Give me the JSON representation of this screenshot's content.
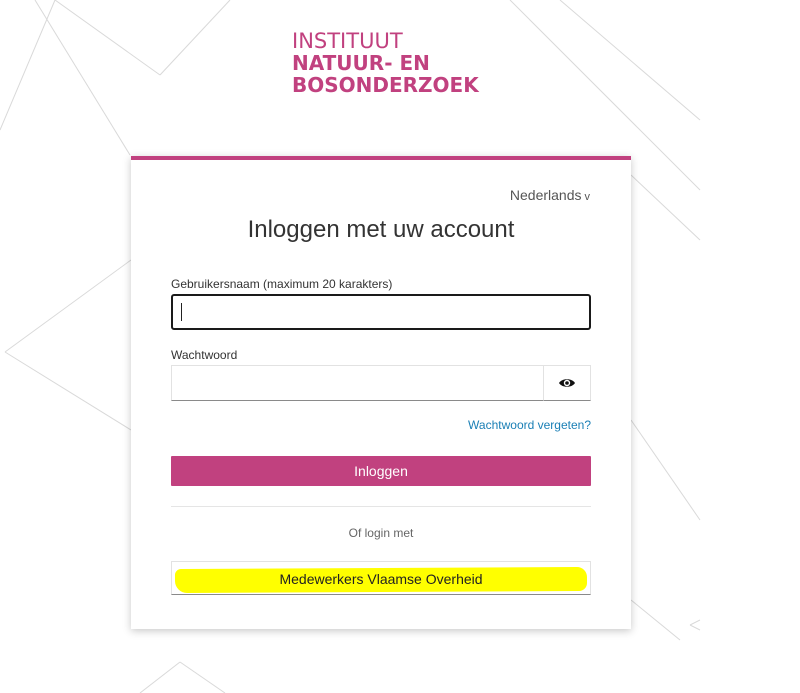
{
  "brand": {
    "line1": "INSTITUUT",
    "line2": "NATUUR- EN",
    "line3": "BOSONDERZOEK",
    "color": "#c1417f"
  },
  "language": {
    "selected": "Nederlands",
    "chevron": "v"
  },
  "form": {
    "title": "Inloggen met uw account",
    "username_label": "Gebruikersnaam (maximum 20 karakters)",
    "username_value": "",
    "password_label": "Wachtwoord",
    "password_value": "",
    "show_password_icon": "eye-icon",
    "forgot_password": "Wachtwoord vergeten?",
    "submit_label": "Inloggen",
    "submit_color": "#c1417f",
    "or_login_with": "Of login met",
    "alt_provider_label": "Medewerkers Vlaamse Overheid",
    "link_color": "#1a7fb5",
    "highlight_color": "#ffff00"
  }
}
